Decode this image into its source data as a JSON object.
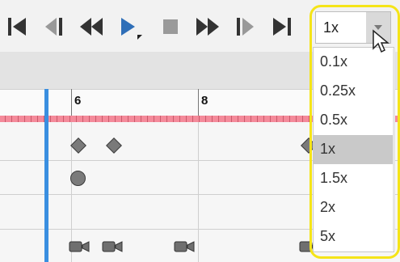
{
  "toolbar": {
    "icons": [
      "skip-to-start-icon",
      "step-back-icon",
      "rewind-icon",
      "play-icon",
      "stop-icon",
      "fast-forward-icon",
      "step-forward-icon",
      "skip-to-end-icon"
    ]
  },
  "timeline": {
    "ruler_labels": [
      "6",
      "8"
    ]
  },
  "speed": {
    "selected": "1x",
    "options": [
      "0.1x",
      "0.25x",
      "0.5x",
      "1x",
      "1.5x",
      "2x",
      "5x"
    ]
  },
  "colors": {
    "accent": "#3a8fe0",
    "ruler_strip": "#f48a9a",
    "highlight": "#f5e418",
    "play": "#2f6fb8"
  }
}
